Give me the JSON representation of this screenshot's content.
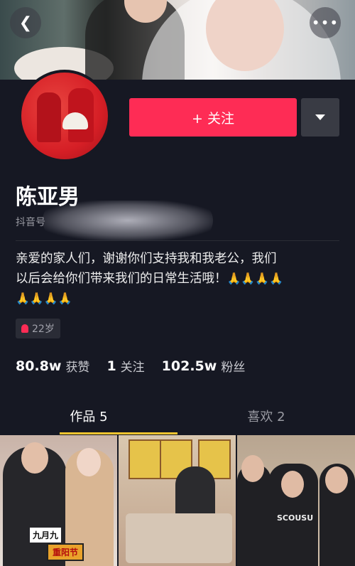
{
  "header": {
    "back_icon": "chevron-left-icon",
    "more_icon": "more-horizontal-icon"
  },
  "profile": {
    "follow_label": "+ 关注",
    "dropdown_icon": "caret-down-icon",
    "name": "陈亚男",
    "douyin_id_label": "抖音号",
    "bio_line1": "亲爱的家人们，谢谢你们支持我和我老公，我们",
    "bio_line2": "以后会给你们带来我们的日常生活哦！",
    "bio_emoji_line2": "🙏🙏🙏🙏",
    "bio_emoji_line3": "🙏🙏🙏🙏",
    "age_badge": "22岁"
  },
  "stats": {
    "likes_value": "80.8w",
    "likes_label": "获赞",
    "following_value": "1",
    "following_label": "关注",
    "followers_value": "102.5w",
    "followers_label": "粉丝"
  },
  "tabs": [
    {
      "label": "作品 5",
      "active": true
    },
    {
      "label": "喜欢 2",
      "active": false
    }
  ],
  "thumbnails": [
    {
      "tag_top": "九月九",
      "tag_bottom": "重阳节"
    },
    {},
    {
      "shirt_text": "SCOUSU"
    }
  ],
  "colors": {
    "background": "#161823",
    "accent": "#fe2c55",
    "tab_underline": "#f4c430"
  }
}
